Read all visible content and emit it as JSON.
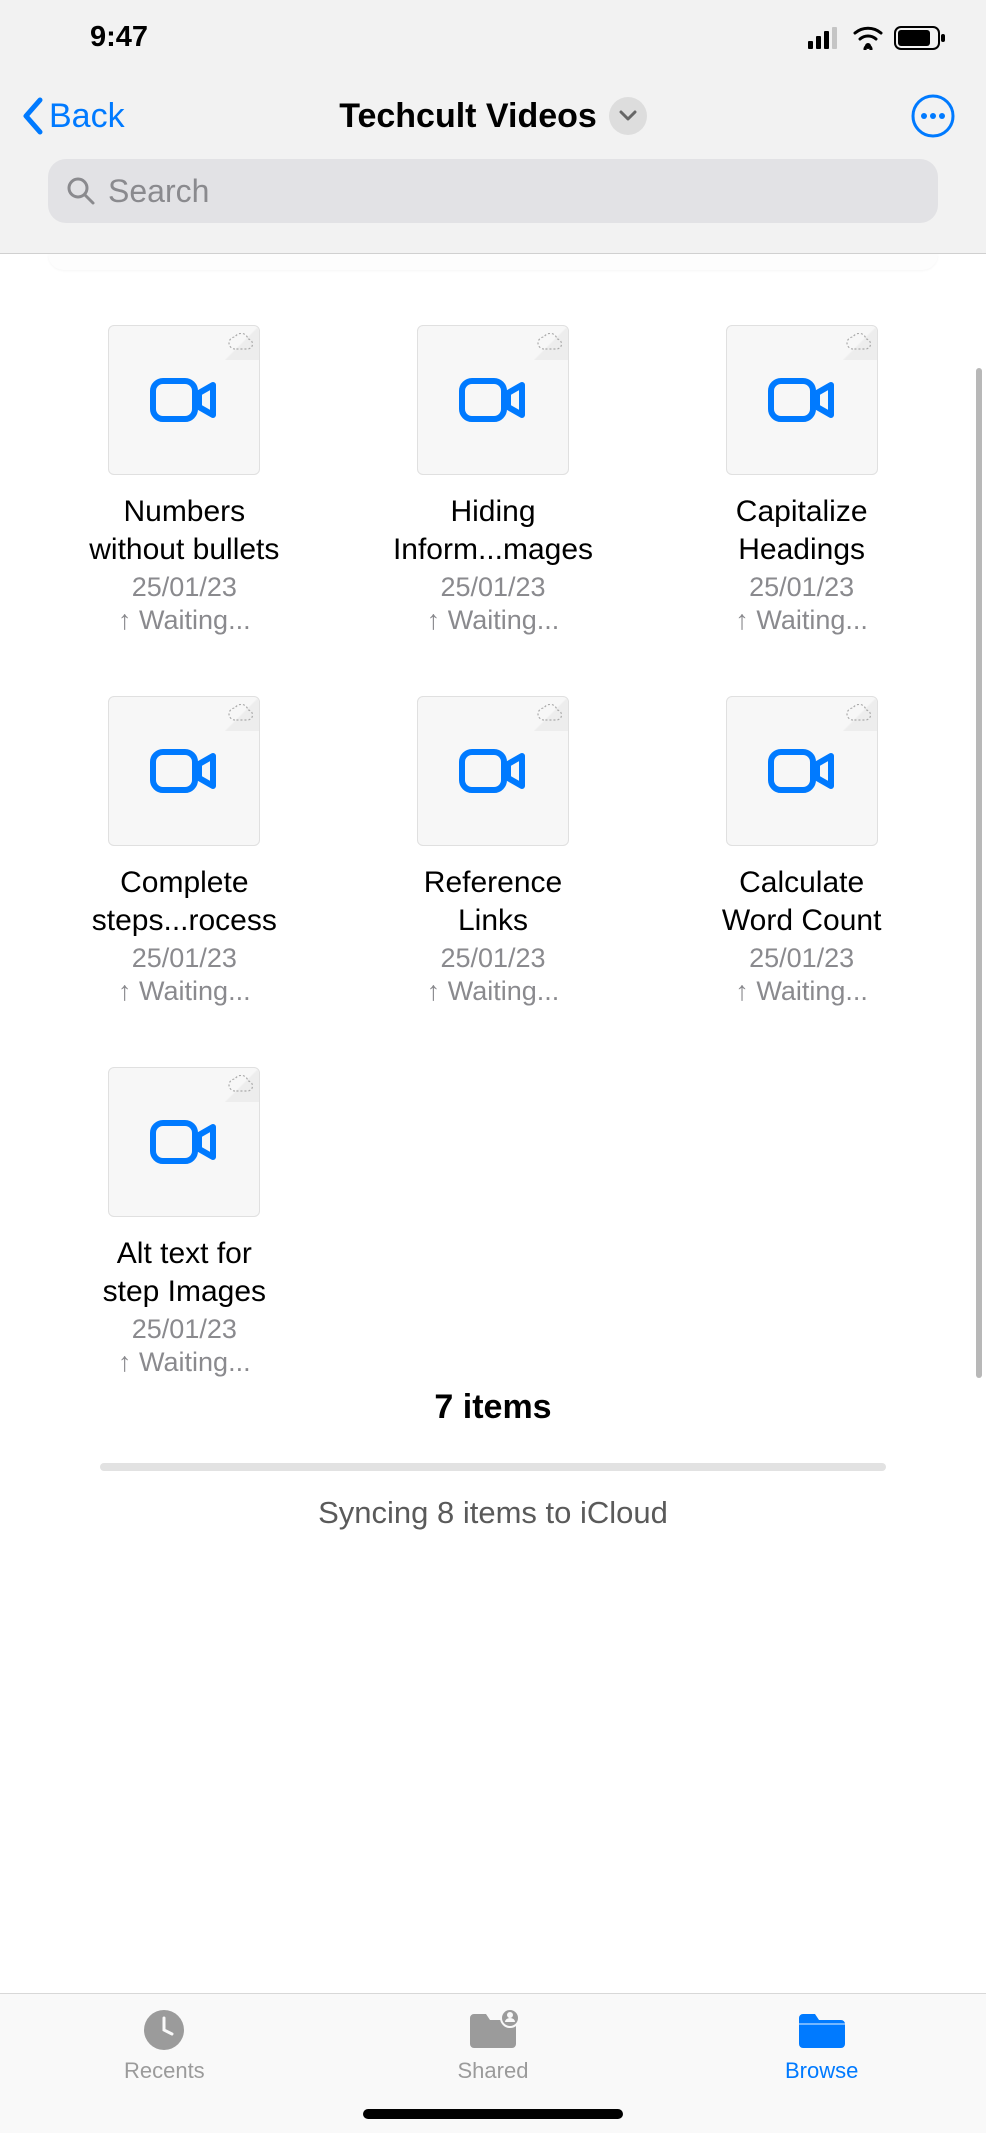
{
  "status": {
    "time": "9:47"
  },
  "header": {
    "back_label": "Back",
    "title": "Techcult Videos"
  },
  "search": {
    "placeholder": "Search"
  },
  "files": [
    {
      "name_line1": "Numbers",
      "name_line2": "without bullets",
      "date": "25/01/23",
      "status": "↑ Waiting..."
    },
    {
      "name_line1": "Hiding",
      "name_line2": "Inform...mages",
      "date": "25/01/23",
      "status": "↑ Waiting..."
    },
    {
      "name_line1": "Capitalize",
      "name_line2": "Headings",
      "date": "25/01/23",
      "status": "↑ Waiting..."
    },
    {
      "name_line1": "Complete",
      "name_line2": "steps...rocess",
      "date": "25/01/23",
      "status": "↑ Waiting..."
    },
    {
      "name_line1": "Reference",
      "name_line2": "Links",
      "date": "25/01/23",
      "status": "↑ Waiting..."
    },
    {
      "name_line1": "Calculate",
      "name_line2": "Word Count",
      "date": "25/01/23",
      "status": "↑ Waiting..."
    },
    {
      "name_line1": "Alt text for",
      "name_line2": "step Images",
      "date": "25/01/23",
      "status": "↑ Waiting..."
    }
  ],
  "footer": {
    "item_count": "7 items",
    "sync_text": "Syncing 8 items to iCloud"
  },
  "tabs": {
    "recents": "Recents",
    "shared": "Shared",
    "browse": "Browse"
  }
}
